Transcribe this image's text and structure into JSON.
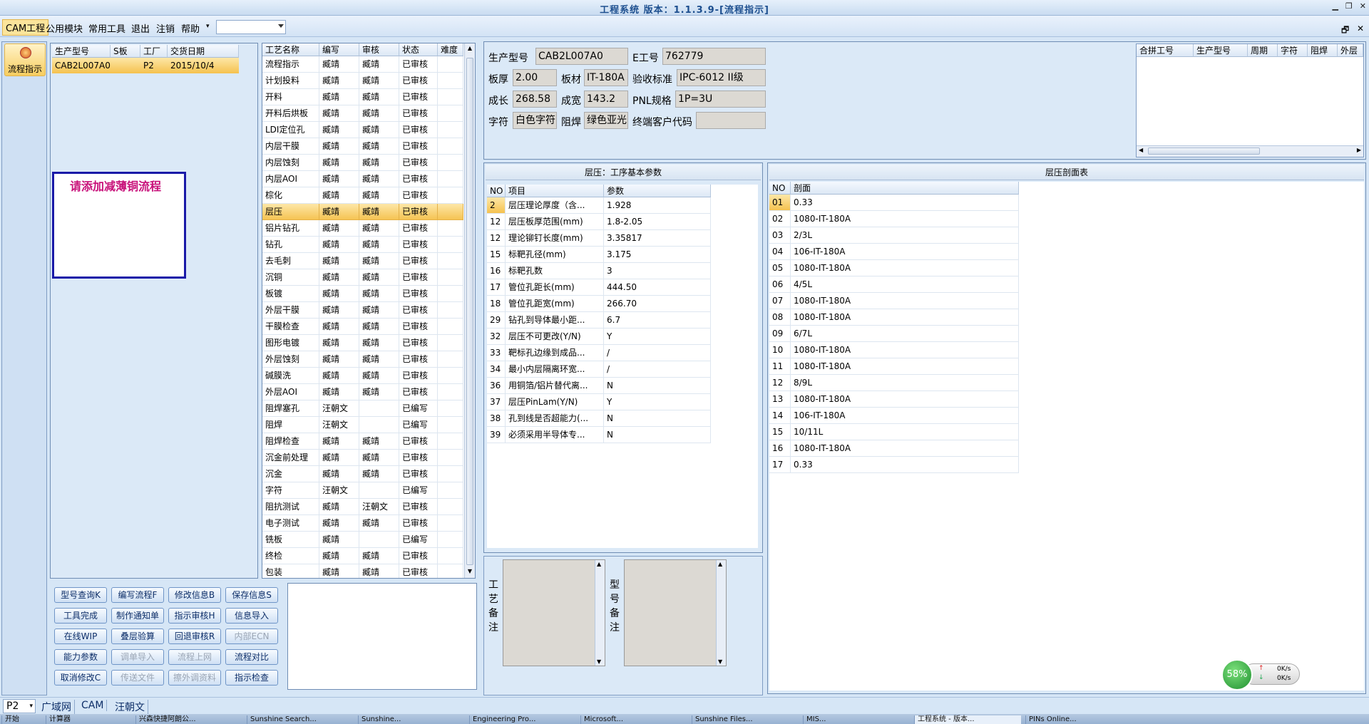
{
  "title": "工程系统 版本：1.1.3.9-[流程指示]",
  "menu": [
    "CAM工程",
    "公用模块",
    "常用工具",
    "退出",
    "注销",
    "帮助"
  ],
  "menu_combo_value": "",
  "left_button": "流程指示",
  "orders": {
    "headers": [
      "生产型号",
      "S板",
      "工厂",
      "交货日期"
    ],
    "rows": [
      [
        "CAB2L007A0",
        "",
        "P2",
        "2015/10/4"
      ]
    ]
  },
  "notice": "请添加减薄铜流程",
  "process": {
    "headers": [
      "工艺名称",
      "编写",
      "审核",
      "状态",
      "难度"
    ],
    "rows": [
      [
        "流程指示",
        "臧靖",
        "臧靖",
        "已审核",
        ""
      ],
      [
        "计划投料",
        "臧靖",
        "臧靖",
        "已审核",
        ""
      ],
      [
        "开料",
        "臧靖",
        "臧靖",
        "已审核",
        ""
      ],
      [
        "开料后烘板",
        "臧靖",
        "臧靖",
        "已审核",
        ""
      ],
      [
        "LDI定位孔",
        "臧靖",
        "臧靖",
        "已审核",
        ""
      ],
      [
        "内层干膜",
        "臧靖",
        "臧靖",
        "已审核",
        ""
      ],
      [
        "内层蚀刻",
        "臧靖",
        "臧靖",
        "已审核",
        ""
      ],
      [
        "内层AOI",
        "臧靖",
        "臧靖",
        "已审核",
        ""
      ],
      [
        "棕化",
        "臧靖",
        "臧靖",
        "已审核",
        ""
      ],
      [
        "层压",
        "臧靖",
        "臧靖",
        "已审核",
        ""
      ],
      [
        "铝片钻孔",
        "臧靖",
        "臧靖",
        "已审核",
        ""
      ],
      [
        "钻孔",
        "臧靖",
        "臧靖",
        "已审核",
        ""
      ],
      [
        "去毛刺",
        "臧靖",
        "臧靖",
        "已审核",
        ""
      ],
      [
        "沉铜",
        "臧靖",
        "臧靖",
        "已审核",
        ""
      ],
      [
        "板镀",
        "臧靖",
        "臧靖",
        "已审核",
        ""
      ],
      [
        "外层干膜",
        "臧靖",
        "臧靖",
        "已审核",
        ""
      ],
      [
        "干膜检查",
        "臧靖",
        "臧靖",
        "已审核",
        ""
      ],
      [
        "图形电镀",
        "臧靖",
        "臧靖",
        "已审核",
        ""
      ],
      [
        "外层蚀刻",
        "臧靖",
        "臧靖",
        "已审核",
        ""
      ],
      [
        "碱膜洗",
        "臧靖",
        "臧靖",
        "已审核",
        ""
      ],
      [
        "外层AOI",
        "臧靖",
        "臧靖",
        "已审核",
        ""
      ],
      [
        "阻焊塞孔",
        "汪朝文",
        "",
        "已编写",
        ""
      ],
      [
        "阻焊",
        "汪朝文",
        "",
        "已编写",
        ""
      ],
      [
        "阻焊检查",
        "臧靖",
        "臧靖",
        "已审核",
        ""
      ],
      [
        "沉金前处理",
        "臧靖",
        "臧靖",
        "已审核",
        ""
      ],
      [
        "沉金",
        "臧靖",
        "臧靖",
        "已审核",
        ""
      ],
      [
        "字符",
        "汪朝文",
        "",
        "已编写",
        ""
      ],
      [
        "阻抗测试",
        "臧靖",
        "汪朝文",
        "已审核",
        ""
      ],
      [
        "电子测试",
        "臧靖",
        "臧靖",
        "已审核",
        ""
      ],
      [
        "铣板",
        "臧靖",
        "",
        "已编写",
        ""
      ],
      [
        "终检",
        "臧靖",
        "臧靖",
        "已审核",
        ""
      ],
      [
        "包装",
        "臧靖",
        "臧靖",
        "已审核",
        ""
      ]
    ],
    "selected_index": 9
  },
  "buttons": [
    [
      "型号查询K",
      "编写流程F",
      "修改信息B",
      "保存信息S"
    ],
    [
      "工具完成",
      "制作通知单",
      "指示审核H",
      "信息导入"
    ],
    [
      "在线WIP",
      "叠层验算",
      "回退审核R",
      "内部ECN"
    ],
    [
      "能力参数",
      "调单导入",
      "流程上网",
      "流程对比"
    ],
    [
      "取消修改C",
      "传送文件",
      "擦外调资料",
      "指示检查"
    ]
  ],
  "disabled_buttons": [
    "内部ECN",
    "调单导入",
    "流程上网",
    "传送文件",
    "擦外调资料"
  ],
  "info": {
    "生产型号": {
      "label": "生产型号",
      "value": "CAB2L007A0"
    },
    "E工号": {
      "label": "E工号",
      "value": "762779"
    },
    "板厚": {
      "label": "板厚",
      "value": "2.00"
    },
    "板材": {
      "label": "板材",
      "value": "IT-180A"
    },
    "验收标准": {
      "label": "验收标准",
      "value": "IPC-6012 II级"
    },
    "成长": {
      "label": "成长",
      "value": "268.58"
    },
    "成宽": {
      "label": "成宽",
      "value": "143.2"
    },
    "PNL规格": {
      "label": "PNL规格",
      "value": "1P=3U"
    },
    "字符": {
      "label": "字符",
      "value": "白色字符"
    },
    "阻焊": {
      "label": "阻焊",
      "value": "绿色亚光"
    },
    "终端客户代码": {
      "label": "终端客户代码",
      "value": ""
    }
  },
  "combine": {
    "headers": [
      "合拼工号",
      "生产型号",
      "周期",
      "字符",
      "阻焊",
      "外层"
    ]
  },
  "params": {
    "title": "层压：工序基本参数",
    "headers": [
      "NO",
      "项目",
      "参数"
    ],
    "rows": [
      [
        "2",
        "层压理论厚度（含...",
        "1.928"
      ],
      [
        "12",
        "层压板厚范围(mm)",
        "1.8-2.05"
      ],
      [
        "12",
        "理论铆钉长度(mm)",
        "3.35817"
      ],
      [
        "15",
        "标靶孔径(mm)",
        "3.175"
      ],
      [
        "16",
        "标靶孔数",
        "3"
      ],
      [
        "17",
        "管位孔距长(mm)",
        "444.50"
      ],
      [
        "18",
        "管位孔距宽(mm)",
        "266.70"
      ],
      [
        "29",
        "钻孔到导体最小距...",
        "6.7"
      ],
      [
        "32",
        "层压不可更改(Y/N)",
        "Y"
      ],
      [
        "33",
        "靶标孔边缘到成品...",
        "/"
      ],
      [
        "34",
        "最小内层隔离环宽...",
        "/"
      ],
      [
        "36",
        "用铜箔/铝片替代离...",
        "N"
      ],
      [
        "37",
        "层压PinLam(Y/N)",
        "Y"
      ],
      [
        "38",
        "孔到线是否超能力(...",
        "N"
      ],
      [
        "39",
        "必须采用半导体专...",
        "N"
      ]
    ]
  },
  "stack": {
    "title": "层压剖面表",
    "headers": [
      "NO",
      "剖面"
    ],
    "rows": [
      [
        "01",
        "0.33"
      ],
      [
        "02",
        "1080-IT-180A"
      ],
      [
        "03",
        "2/3L"
      ],
      [
        "04",
        "106-IT-180A"
      ],
      [
        "05",
        "1080-IT-180A"
      ],
      [
        "06",
        "4/5L"
      ],
      [
        "07",
        "1080-IT-180A"
      ],
      [
        "08",
        "1080-IT-180A"
      ],
      [
        "09",
        "6/7L"
      ],
      [
        "10",
        "1080-IT-180A"
      ],
      [
        "11",
        "1080-IT-180A"
      ],
      [
        "12",
        "8/9L"
      ],
      [
        "13",
        "1080-IT-180A"
      ],
      [
        "14",
        "106-IT-180A"
      ],
      [
        "15",
        "10/11L"
      ],
      [
        "16",
        "1080-IT-180A"
      ],
      [
        "17",
        "0.33"
      ]
    ]
  },
  "notes": {
    "process_label": "工艺备注",
    "model_label": "型号备注"
  },
  "network": {
    "percent": "58%",
    "up": "0K/s",
    "down": "0K/s"
  },
  "statusbar": {
    "factory": "P2",
    "net": "广域网",
    "dept": "CAM",
    "user": "汪朝文"
  },
  "taskbar": [
    "开始",
    "计算器",
    "兴森快捷阿朗公...",
    "Sunshine Search...",
    "Sunshine...",
    "Engineering Pro...",
    "Microsoft...",
    "Sunshine Files...",
    "MIS...",
    "工程系统 - 版本...",
    "PINs Online..."
  ],
  "colors": {
    "accent": "#f5c24f",
    "notice": "#c8117a",
    "frame": "#1a1aa8"
  }
}
